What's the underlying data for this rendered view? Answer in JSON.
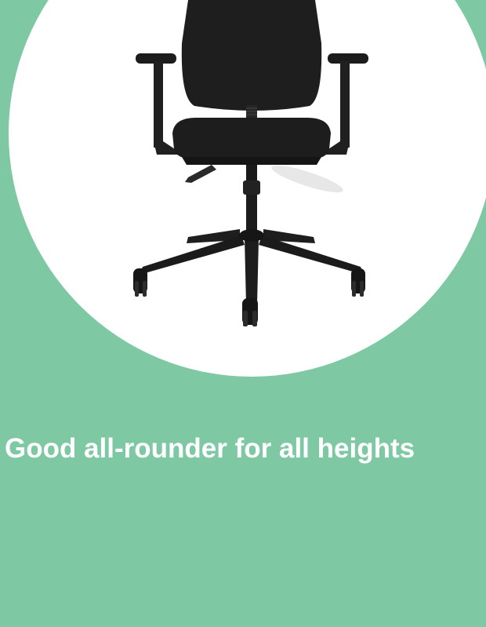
{
  "product": {
    "image_icon": "office-chair-icon",
    "caption": "Good all-rounder for all heights",
    "colors": {
      "background": "#7ec9a4",
      "circle": "#ffffff",
      "chair": "#1f1f1f",
      "caption": "#ffffff"
    }
  }
}
